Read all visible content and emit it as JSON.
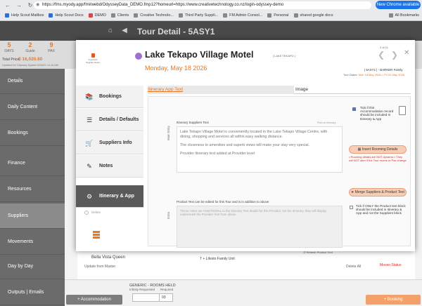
{
  "browser": {
    "url": "https://fms.myody.app/fmi/webd/OdysseyData_DEMO.fmp12?homeurl=https://www.creativetechnology.co.nz/login-odyssey-demo",
    "new_chrome_label": "New Chrome available",
    "bookmarks": [
      {
        "label": "Help Scout Mailbox",
        "color": "#2a6fdb"
      },
      {
        "label": "Help Scout Docs",
        "color": "#2a6fdb"
      },
      {
        "label": "DEMO",
        "color": "#d44"
      },
      {
        "label": "Clients",
        "color": "#666"
      },
      {
        "label": "Creative Technolo...",
        "color": "#666"
      },
      {
        "label": "Third Party Suppli...",
        "color": "#666"
      },
      {
        "label": "FM Admin Consol...",
        "color": "#666"
      },
      {
        "label": "Personal",
        "color": "#666"
      },
      {
        "label": "shared google docs",
        "color": "#666"
      }
    ],
    "all_bookmarks_label": "All Bookmarks"
  },
  "header": {
    "title": "Tour Detail - 5ASY1"
  },
  "stats": {
    "items": [
      {
        "num": "5",
        "label": "DAYS"
      },
      {
        "num": "2",
        "label": "Guide"
      },
      {
        "num": "9",
        "label": "PAX"
      }
    ],
    "total_price_label": "Total Price",
    "total_price_value": "$ 16,020.80",
    "updated_text": "Updated for Odyssey System   6/06/21 11:15 AM"
  },
  "sidebar": {
    "items": [
      {
        "label": "Details"
      },
      {
        "label": "Daily Content"
      },
      {
        "label": "Bookings"
      },
      {
        "label": "Finance"
      },
      {
        "label": "Resources"
      },
      {
        "label": "Suppliers"
      },
      {
        "label": "Movements"
      },
      {
        "label": "Day by Day"
      },
      {
        "label": "Outputs | Emails"
      }
    ]
  },
  "modal": {
    "logo_text": "Important Supplier Notes",
    "supplier_name": "Lake Tekapo Village Motel",
    "supplier_location": "| LAKE TEKAPO |",
    "date": "Monday, May 18 2026",
    "pager": "2 of 11",
    "family": "| 5ASY1 | - BARKER Family",
    "tour_dates_label": "Tour Dates: ",
    "tour_dates_value": "Mon 18 May 2026 > Fri 22 May 2026",
    "nav": [
      {
        "label": "Bookings",
        "icon": "bookings-icon"
      },
      {
        "label": "Details / Defaults",
        "icon": "details-icon"
      },
      {
        "label": "Suppliers Info",
        "icon": "cart-icon"
      },
      {
        "label": "Notes",
        "icon": "notes-icon"
      },
      {
        "label": "Itinerary & App",
        "icon": "itinerary-icon"
      }
    ],
    "delete_label": "Delete",
    "tabs": {
      "itinerary": "Itinerary App Text",
      "image": "Image"
    },
    "suppliers_text_title": "Itinerary Suppliers Text",
    "print_label": "Print on Itinerary",
    "main_entry_label": "Main Entry",
    "suppliers_text": [
      "Lake Tekapo Village Motel is conveniently located in the Lake Tekapo Village Centre, with dining, shopping and services all within easy walking distance.",
      "The closeness to amenities and superb views will make your stay very special.",
      "Provider Itinerary text added at Provider level"
    ],
    "additional_title": "Product Text can be edited for this Tour and is in addition to above",
    "additional_placeholder": "These notes are ADDITIONAL to the Itinerary Text details for this Provider. On the Itinerary, they will display underneath the Provider Text from above",
    "extra_label": "Extra",
    "refresh_label": "Refresh Product Text",
    "tick_text": "Tick if this Accommodation record should be included in Itinerary & App",
    "insert_rooming_label": "Insert Rooming Details",
    "rooming_note": "• Rooming details are NOT dynamic • They will NOT alter if the Tour rooms or Pax change",
    "merge_label": "Merge Suppliers & Product Text",
    "tick_only_text": "Tick if ONLY the Product text block should be included in Itinerary & App and not the Suppliers block"
  },
  "page_bottom": {
    "accommodation_btn": "+ Accommodation",
    "generic_title": "GENERIC - ROOMS HELD",
    "infinity_requested": "Infinity Requested",
    "required": "Required",
    "qty": "03",
    "booking_btn": "+ Booking",
    "update_label": "Update from Master",
    "behind_name": "Bella Vista Queen",
    "behind_name2": "T + Lifestn Family Unit",
    "delete_all": "Delete All",
    "moven_label": "Moven Status"
  }
}
